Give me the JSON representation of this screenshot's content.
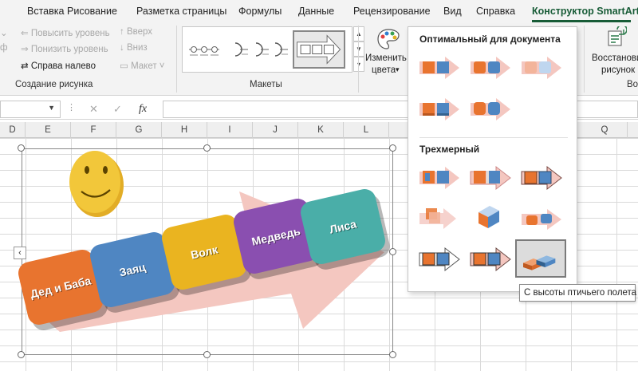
{
  "tabs": [
    "Вставка",
    "Рисование",
    "Разметка страницы",
    "Формулы",
    "Данные",
    "Рецензирование",
    "Вид",
    "Справка",
    "Конструктор SmartArt"
  ],
  "ribbon": {
    "create_group": {
      "label": "Создание рисунка",
      "promote": "Повысить уровень",
      "demote": "Понизить уровень",
      "right_to_left": "Справа налево",
      "move_up": "Вверх",
      "move_down": "Вниз",
      "layout": "Макет"
    },
    "layouts_group": {
      "label": "Макеты"
    },
    "change_colors": {
      "line1": "Изменить",
      "line2": "цвета"
    },
    "reset": {
      "line1": "Восстанови",
      "line2": "рисунок"
    },
    "reset_group_label": "Вос"
  },
  "formula_bar": {
    "fx": "fx",
    "cancel": "✕",
    "enter": "✓"
  },
  "columns": [
    "D",
    "E",
    "F",
    "G",
    "H",
    "I",
    "J",
    "K",
    "L",
    "Q"
  ],
  "smartart": {
    "blocks": [
      {
        "text": "Дед и Баба",
        "color": "#e8742f"
      },
      {
        "text": "Заяц",
        "color": "#4f86c2"
      },
      {
        "text": "Волк",
        "color": "#eab420"
      },
      {
        "text": "Медведь",
        "color": "#8a4fb0"
      },
      {
        "text": "Лиса",
        "color": "#4aaea8"
      }
    ],
    "arrow_color": "#f4c7c0",
    "smiley_color": "#f2c73a",
    "text_pane_glyph": "‹"
  },
  "dropdown": {
    "section1": "Оптимальный для документа",
    "section2": "Трехмерный",
    "selected_tooltip": "С высоты птичьего полета"
  },
  "colors": {
    "accent": "#185c37",
    "ribbon_bg": "#f3f3f3",
    "block_orange": "#e8742f",
    "block_blue": "#4f86c2"
  }
}
